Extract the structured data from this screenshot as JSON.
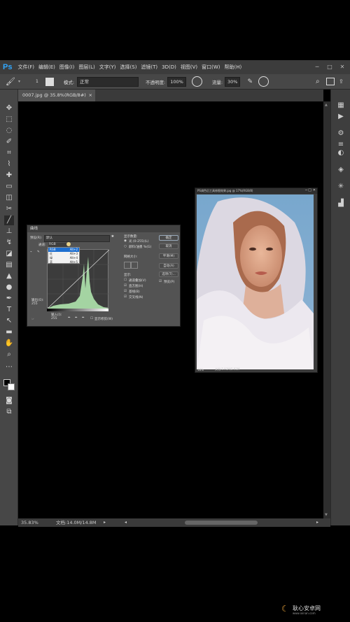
{
  "app": {
    "logo": "Ps"
  },
  "menu": [
    "文件(F)",
    "编辑(E)",
    "图像(I)",
    "图层(L)",
    "文字(Y)",
    "选择(S)",
    "滤镜(T)",
    "3D(D)",
    "视图(V)",
    "窗口(W)",
    "帮助(H)"
  ],
  "options": {
    "mode_label": "模式:",
    "mode_value": "正常",
    "opacity_label": "不透明度:",
    "opacity_value": "100%",
    "flow_label": "流量:",
    "flow_value": "30%"
  },
  "document_tab": {
    "title": "0007.jpg @ 35.8%(RGB/8#)",
    "close": "×"
  },
  "status": {
    "zoom": "35.83%",
    "doc_info": "文档:14.0M/14.8M"
  },
  "curves_dialog": {
    "title": "曲线",
    "preset_label": "预设(R):",
    "preset_value": "默认",
    "channel_label": "通道:",
    "channel_value": "RGB",
    "channels": [
      {
        "name": "RGB",
        "shortcut": "Alt+2"
      },
      {
        "name": "红",
        "shortcut": "Alt+3"
      },
      {
        "name": "绿",
        "shortcut": "Alt+4"
      },
      {
        "name": "蓝",
        "shortcut": "Alt+5"
      }
    ],
    "output_label": "输出(O):",
    "output_value": "255",
    "input_label": "输入(I):",
    "input_value": "255",
    "show_clipping": "显示修剪(W)",
    "display_amount_label": "显示数量:",
    "light_option": "光 (0-255)(L)",
    "pigment_option": "颜料/油墨 %(G)",
    "grid_size_label": "网格大小:",
    "show_label": "显示:",
    "show_channel_overlays": "通道叠加(V)",
    "show_histogram": "直方图(H)",
    "show_baseline": "基线(B)",
    "show_intersection": "交叉线(N)",
    "buttons": [
      "确定",
      "取消",
      "平滑(M)",
      "自动(A)",
      "选项(T)..."
    ],
    "preview_label": "预览(P)"
  },
  "image_window": {
    "title": "PS调色后工具修图效果.jpg @ 17%(RGB/8)",
    "zoom": "18%",
    "info": "文档:5.93M/5.93M"
  },
  "watermark": {
    "text": "耿心安卓网",
    "subtext": "www.ixinan.com"
  },
  "colors": {
    "background": "#000000",
    "panel": "#474747",
    "menubar": "#3c3c3c",
    "accent": "#31a8ff",
    "histogram": "#a4d4a2"
  }
}
